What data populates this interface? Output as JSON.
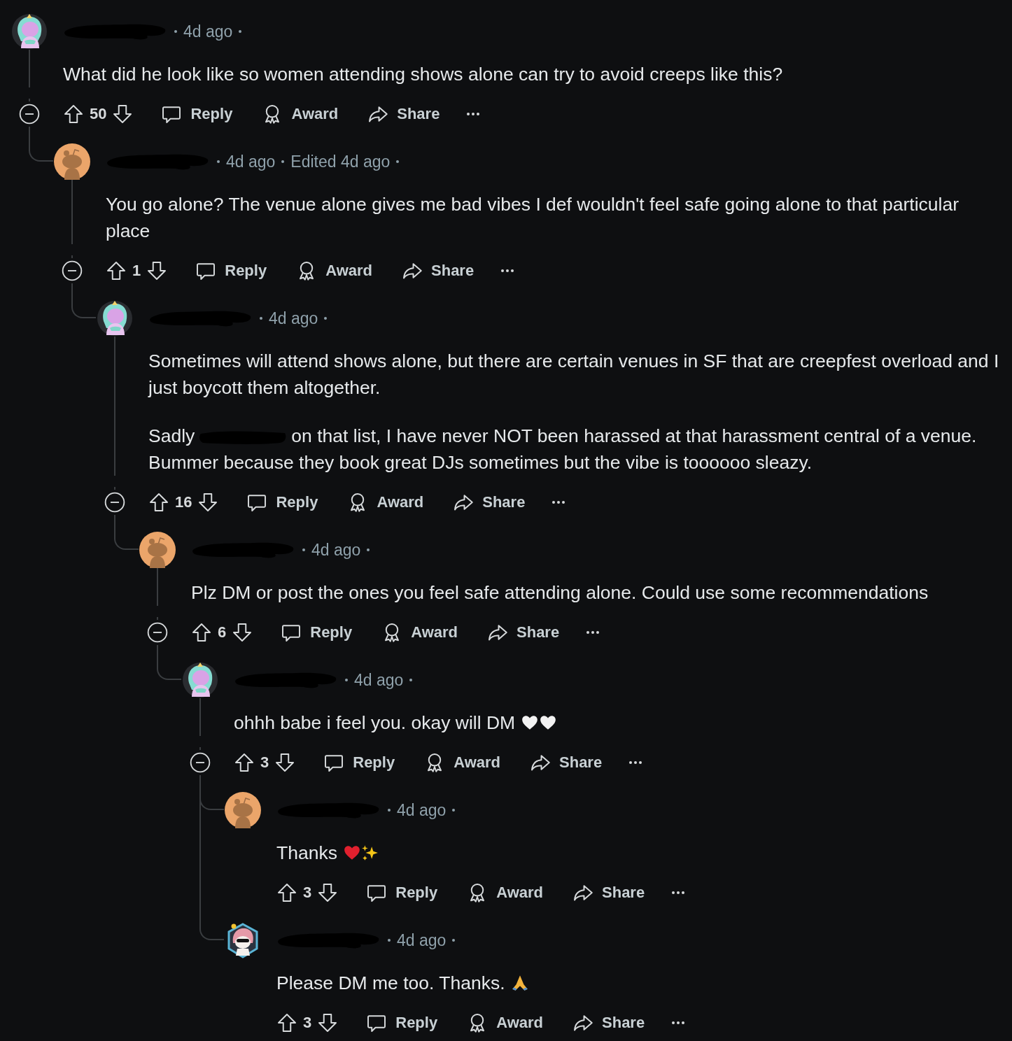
{
  "comments": [
    {
      "avatar": {
        "kind": "unicorn"
      },
      "time": "4d ago",
      "body": [
        [
          {
            "kind": "text",
            "text": "What did he look like so women attending shows alone can try to avoid creeps like this?"
          }
        ]
      ],
      "votes": "50",
      "actions": [
        "Reply",
        "Award",
        "Share"
      ],
      "collapsible": true,
      "children": [
        {
          "avatar": {
            "kind": "snoo"
          },
          "time": "4d ago",
          "edited": "Edited 4d ago",
          "body": [
            [
              {
                "kind": "text",
                "text": "You go alone? The venue alone gives me bad vibes I def wouldn't feel safe going alone to that particular place"
              }
            ]
          ],
          "votes": "1",
          "actions": [
            "Reply",
            "Award",
            "Share"
          ],
          "collapsible": true,
          "children": [
            {
              "avatar": {
                "kind": "unicorn"
              },
              "time": "4d ago",
              "body": [
                [
                  {
                    "kind": "text",
                    "text": "Sometimes will attend shows alone, but there are certain venues in SF that are creepfest overload and I just boycott them altogether."
                  }
                ],
                [
                  {
                    "kind": "text",
                    "text": "Sadly"
                  },
                  {
                    "kind": "redacted"
                  },
                  {
                    "kind": "text",
                    "text": "on that list, I have never NOT been harassed at that harassment central of a venue. Bummer because they book great DJs sometimes but the vibe is toooooo sleazy."
                  }
                ]
              ],
              "votes": "16",
              "actions": [
                "Reply",
                "Award",
                "Share"
              ],
              "collapsible": true,
              "children": [
                {
                  "avatar": {
                    "kind": "snoo"
                  },
                  "time": "4d ago",
                  "body": [
                    [
                      {
                        "kind": "text",
                        "text": "Plz DM or post the ones you feel safe attending alone. Could use some recommendations"
                      }
                    ]
                  ],
                  "votes": "6",
                  "actions": [
                    "Reply",
                    "Award",
                    "Share"
                  ],
                  "collapsible": true,
                  "children": [
                    {
                      "avatar": {
                        "kind": "unicorn"
                      },
                      "time": "4d ago",
                      "body": [
                        [
                          {
                            "kind": "text",
                            "text": "ohhh babe i feel you. okay will DM"
                          },
                          {
                            "kind": "heart",
                            "color": "#f2f2f2"
                          },
                          {
                            "kind": "heart",
                            "color": "#f2f2f2"
                          }
                        ]
                      ],
                      "votes": "3",
                      "actions": [
                        "Reply",
                        "Award",
                        "Share"
                      ],
                      "collapsible": true,
                      "children": [
                        {
                          "avatar": {
                            "kind": "snoo"
                          },
                          "time": "4d ago",
                          "body": [
                            [
                              {
                                "kind": "text",
                                "text": "Thanks"
                              },
                              {
                                "kind": "heart",
                                "color": "#e0202e"
                              },
                              {
                                "kind": "sparkles",
                                "color": "#f5c518"
                              }
                            ]
                          ],
                          "votes": "3",
                          "actions": [
                            "Reply",
                            "Award",
                            "Share"
                          ],
                          "collapsible": false
                        },
                        {
                          "avatar": {
                            "kind": "character"
                          },
                          "time": "4d ago",
                          "body": [
                            [
                              {
                                "kind": "text",
                                "text": "Please DM me too. Thanks."
                              },
                              {
                                "kind": "folded-hands",
                                "color": "#f2b33d"
                              }
                            ]
                          ],
                          "votes": "3",
                          "actions": [
                            "Reply",
                            "Award",
                            "Share"
                          ],
                          "collapsible": false
                        }
                      ]
                    }
                  ]
                }
              ]
            }
          ]
        }
      ]
    }
  ]
}
